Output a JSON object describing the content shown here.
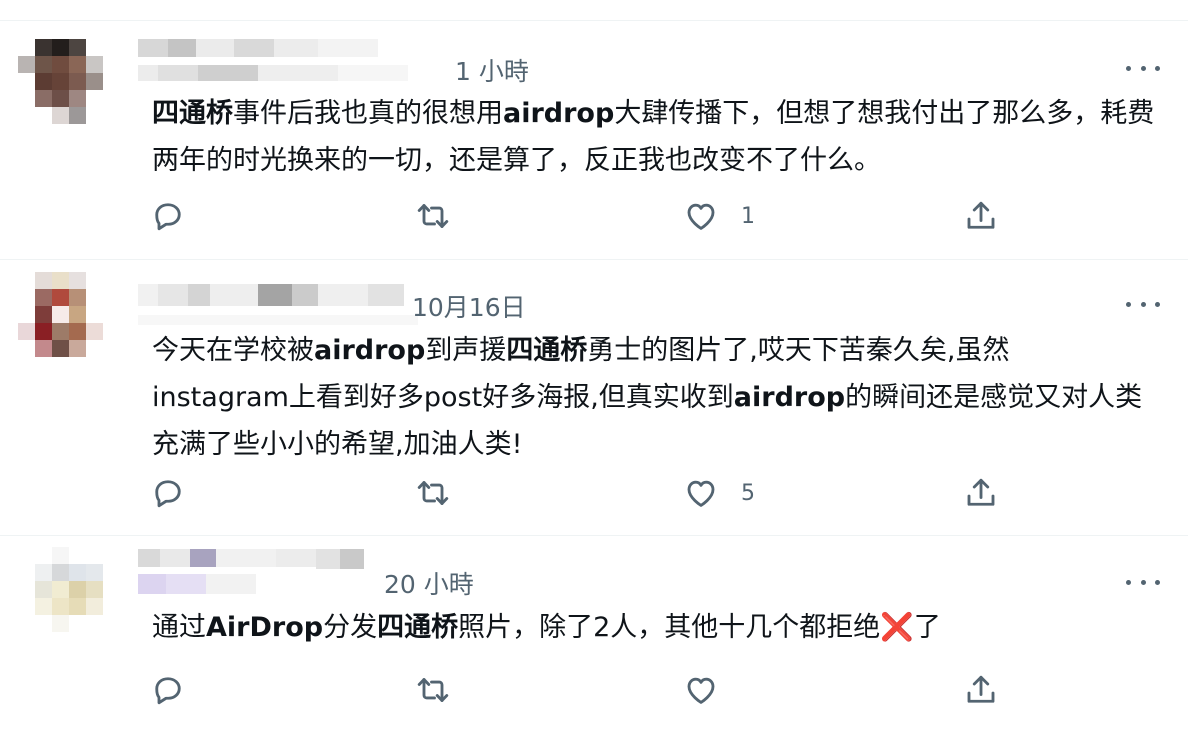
{
  "tweets": [
    {
      "time": "1 小時",
      "text_parts": [
        {
          "t": "四通桥",
          "b": true
        },
        {
          "t": "事件后我也真的很想用",
          "b": false
        },
        {
          "t": "airdrop",
          "b": true
        },
        {
          "t": "大肆传播下，但想了想我付出了那么多，耗费两年的时光换来的一切，还是算了，反正我也改变不了什么。",
          "b": false
        }
      ],
      "likes": "1"
    },
    {
      "time": "10月16日",
      "text_parts": [
        {
          "t": "今天在学校被",
          "b": false
        },
        {
          "t": "airdrop",
          "b": true
        },
        {
          "t": "到声援",
          "b": false
        },
        {
          "t": "四通桥",
          "b": true
        },
        {
          "t": "勇士的图片了,哎天下苦秦久矣,虽然",
          "b": false
        },
        {
          "t": "\n",
          "b": false
        },
        {
          "t": "instagram上看到好多post好多海报,但真实收到",
          "b": false
        },
        {
          "t": "airdrop",
          "b": true
        },
        {
          "t": "的瞬间还是感觉又对人类充满了些小小的希望,加油人类!",
          "b": false
        }
      ],
      "likes": "5"
    },
    {
      "time": "20 小時",
      "text_parts": [
        {
          "t": "通过",
          "b": false
        },
        {
          "t": "AirDrop",
          "b": true
        },
        {
          "t": "分发",
          "b": false
        },
        {
          "t": "四通桥",
          "b": true
        },
        {
          "t": "照片，除了2人，其他十几个都拒绝",
          "b": false
        },
        {
          "t": "❌",
          "b": false,
          "emoji": true
        },
        {
          "t": "了",
          "b": false
        }
      ],
      "likes": ""
    }
  ],
  "icons": {
    "reply": "reply-icon",
    "retweet": "retweet-icon",
    "like": "like-icon",
    "share": "share-icon",
    "more": "more-icon"
  },
  "colors": {
    "text": "#0f1419",
    "secondary": "#536471",
    "divider": "#eff3f4",
    "x_mark": "#dd2e44"
  }
}
